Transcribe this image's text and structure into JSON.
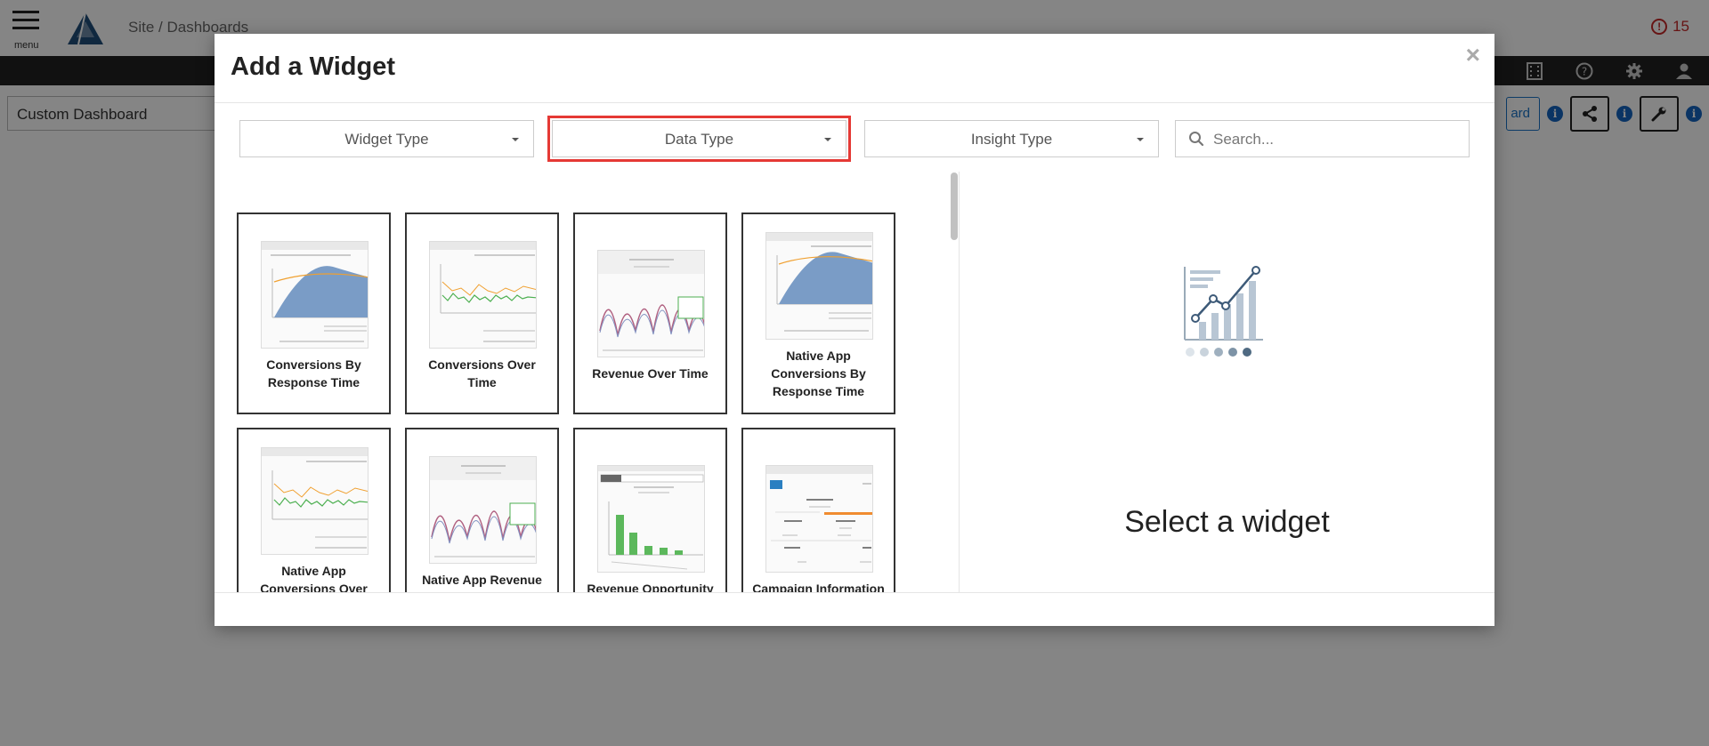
{
  "app": {
    "menu_label": "menu",
    "breadcrumb": "Site / Dashboards",
    "alert_count": "15",
    "dashboard_name": "Custom Dashboard",
    "partial_button_label": "ard"
  },
  "modal": {
    "title": "Add a Widget",
    "close_label": "×",
    "filters": [
      {
        "label": "Widget Type"
      },
      {
        "label": "Data Type"
      },
      {
        "label": "Insight Type"
      }
    ],
    "search_placeholder": "Search...",
    "widgets": [
      {
        "label": "Conversions By Response Time",
        "thumb": "area"
      },
      {
        "label": "Conversions Over Time",
        "thumb": "line"
      },
      {
        "label": "Revenue Over Time",
        "thumb": "wave"
      },
      {
        "label": "Native App Conversions By Response Time",
        "thumb": "area"
      },
      {
        "label": "Native App Conversions Over Time",
        "thumb": "line"
      },
      {
        "label": "Native App Revenue Over Time",
        "thumb": "wave"
      },
      {
        "label": "Revenue Opportunity",
        "thumb": "bars"
      },
      {
        "label": "Campaign Information",
        "thumb": "table"
      }
    ],
    "preview_text": "Select a widget"
  },
  "colors": {
    "highlight": "#e53935",
    "accent": "#1565c0",
    "alert": "#c62828"
  }
}
